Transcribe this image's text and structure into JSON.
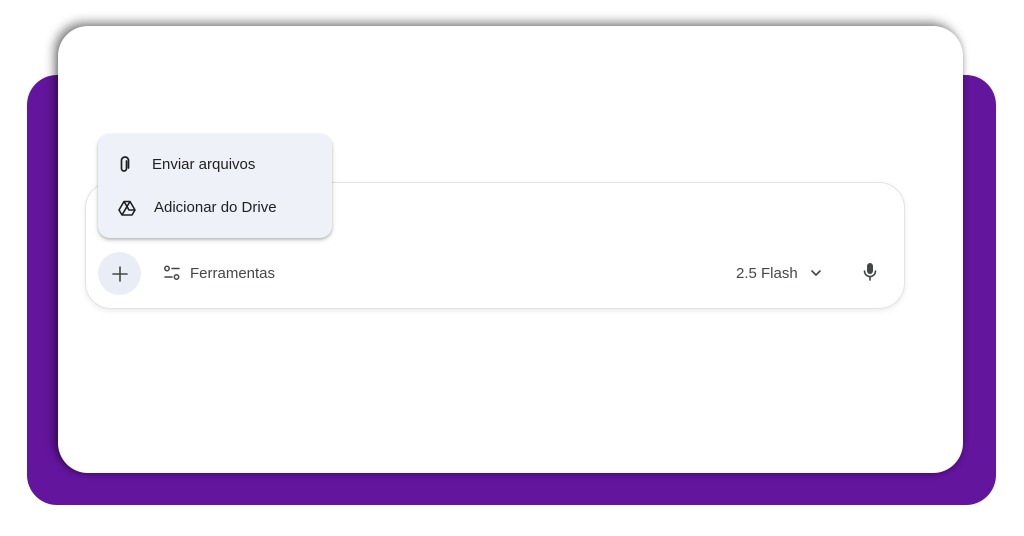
{
  "composer": {
    "tools_label": "Ferramentas",
    "model_label": "2.5 Flash"
  },
  "menu": {
    "items": [
      {
        "label": "Enviar arquivos",
        "icon": "paperclip-icon"
      },
      {
        "label": "Adicionar do Drive",
        "icon": "drive-icon"
      }
    ]
  },
  "icons": {
    "plus": "plus-icon",
    "tools": "tools-sliders-icon",
    "chevron": "chevron-down-icon",
    "mic": "microphone-icon"
  },
  "colors": {
    "backdrop": "#64159e",
    "menu_bg": "#eef2f8",
    "plus_bg": "#e9eef6",
    "text": "#444746"
  }
}
